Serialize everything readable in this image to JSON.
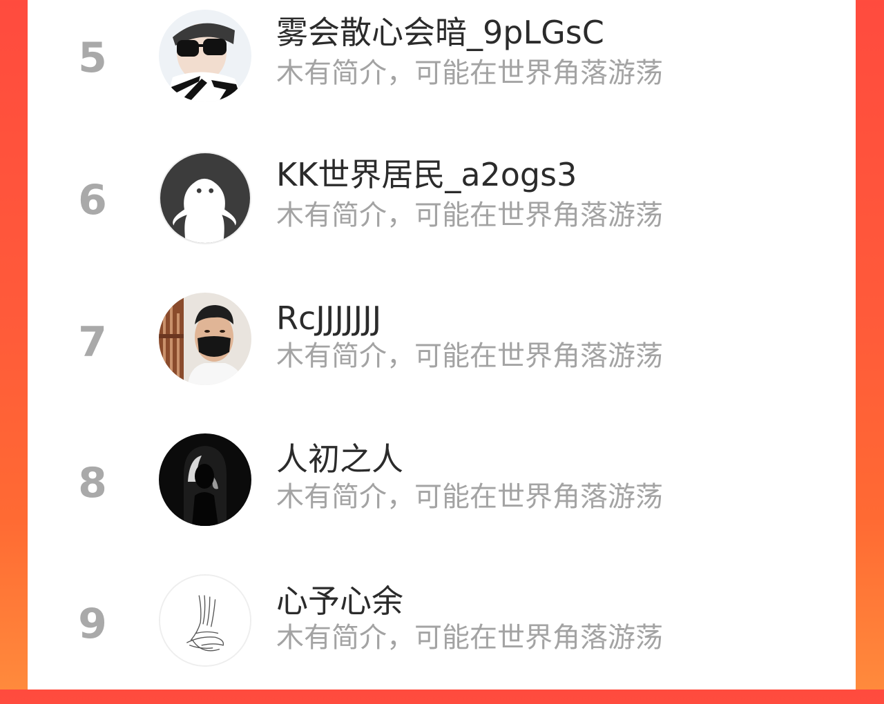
{
  "ranking": {
    "items": [
      {
        "rank": "5",
        "name": "雾会散心会暗_9pLGsC",
        "bio": "木有简介，可能在世界角落游荡",
        "avatar": "sunglasses-boy-avatar"
      },
      {
        "rank": "6",
        "name": "KK世界居民_a2ogs3",
        "bio": "木有简介，可能在世界角落游荡",
        "avatar": "default-ghost-avatar"
      },
      {
        "rank": "7",
        "name": "RcJJJJJJJ",
        "bio": "木有简介，可能在世界角落游荡",
        "avatar": "masked-man-avatar"
      },
      {
        "rank": "8",
        "name": "人初之人",
        "bio": "木有简介，可能在世界角落游荡",
        "avatar": "silhouette-archway-avatar"
      },
      {
        "rank": "9",
        "name": "心予心余",
        "bio": "木有简介，可能在世界角落游荡",
        "avatar": "hands-sketch-avatar"
      }
    ]
  },
  "colors": {
    "background_gradient_top": "#ff4b3e",
    "background_gradient_bottom": "#ff8a3c",
    "rank_number": "#a9a9a9",
    "name_text": "#2b2b2b",
    "bio_text": "#a3a3a3"
  }
}
